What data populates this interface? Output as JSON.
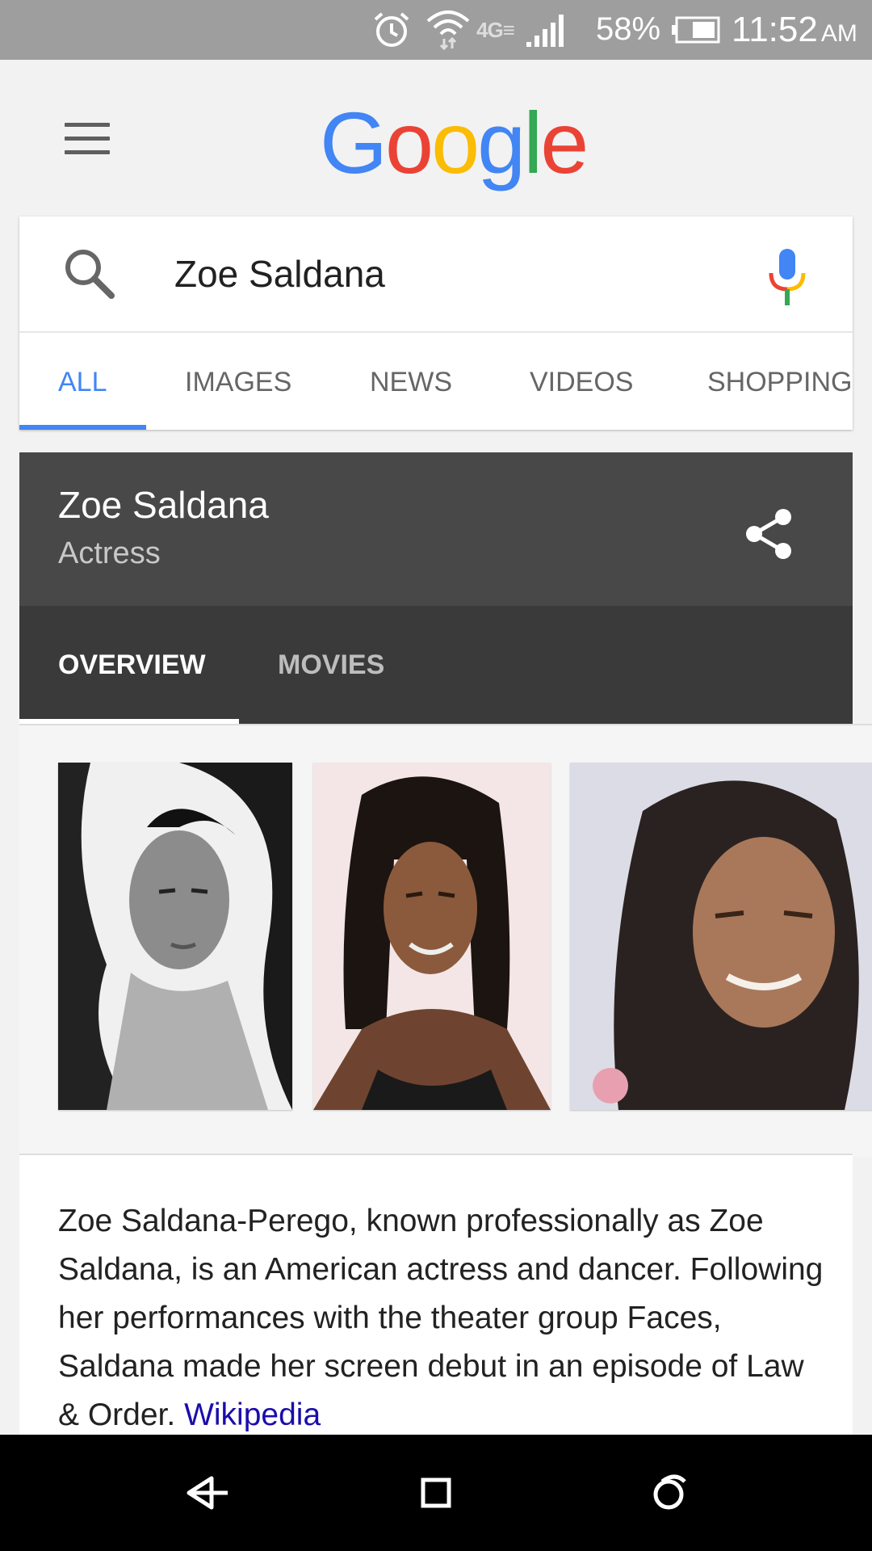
{
  "status_bar": {
    "network": "4G LTE",
    "battery_percent": "58%",
    "time": "11:52",
    "ampm": "AM",
    "icons": [
      "alarm-icon",
      "wifi-icon",
      "lte-icon",
      "signal-icon",
      "battery-icon"
    ]
  },
  "header": {
    "logo_letters": [
      "G",
      "o",
      "o",
      "g",
      "l",
      "e"
    ],
    "menu_icon": "hamburger-menu-icon"
  },
  "search": {
    "query": "Zoe Saldana",
    "icons": [
      "search-icon",
      "microphone-icon"
    ]
  },
  "search_tabs": [
    {
      "label": "ALL",
      "active": true
    },
    {
      "label": "IMAGES",
      "active": false
    },
    {
      "label": "NEWS",
      "active": false
    },
    {
      "label": "VIDEOS",
      "active": false
    },
    {
      "label": "SHOPPING",
      "active": false
    }
  ],
  "knowledge_panel": {
    "title": "Zoe Saldana",
    "subtitle": "Actress",
    "share_icon": "share-icon",
    "tabs": [
      {
        "label": "OVERVIEW",
        "active": true
      },
      {
        "label": "MOVIES",
        "active": false
      }
    ],
    "description": "Zoe Saldana-Perego, known professionally as Zoe Saldana, is an American actress and dancer. Following her performances with the theater group Faces, Saldana made her screen debut in an episode of Law & Order.",
    "source_link": "Wikipedia"
  },
  "navigation_bar": {
    "icons": [
      "back-icon",
      "home-icon",
      "recents-icon"
    ]
  },
  "colors": {
    "google_blue": "#4285f4",
    "google_red": "#ea4335",
    "google_yellow": "#fbbc05",
    "google_green": "#34a853",
    "link": "#1a0dab",
    "panel_dark": "#484848"
  }
}
